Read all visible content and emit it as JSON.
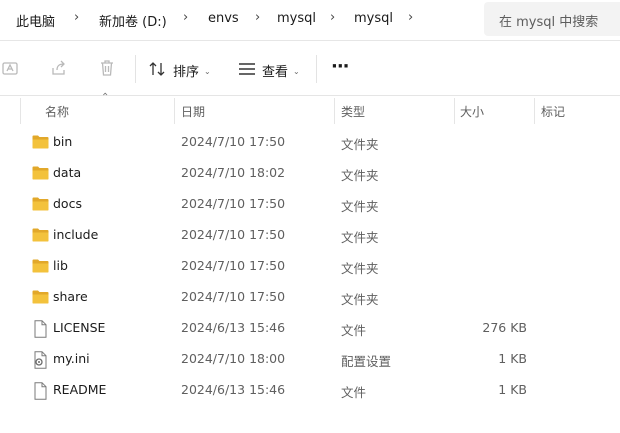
{
  "breadcrumb": [
    "此电脑",
    "新加卷 (D:)",
    "envs",
    "mysql",
    "mysql"
  ],
  "search": {
    "placeholder": "在 mysql 中搜索"
  },
  "toolbar": {
    "sort_label": "排序",
    "view_label": "查看",
    "more_label": "···"
  },
  "columns": {
    "name": "名称",
    "date": "日期",
    "type": "类型",
    "size": "大小",
    "tags": "标记"
  },
  "files": [
    {
      "name": "bin",
      "date": "2024/7/10 17:50",
      "type": "文件夹",
      "size": "",
      "icon": "folder-icon"
    },
    {
      "name": "data",
      "date": "2024/7/10 18:02",
      "type": "文件夹",
      "size": "",
      "icon": "folder-icon"
    },
    {
      "name": "docs",
      "date": "2024/7/10 17:50",
      "type": "文件夹",
      "size": "",
      "icon": "folder-icon"
    },
    {
      "name": "include",
      "date": "2024/7/10 17:50",
      "type": "文件夹",
      "size": "",
      "icon": "folder-icon"
    },
    {
      "name": "lib",
      "date": "2024/7/10 17:50",
      "type": "文件夹",
      "size": "",
      "icon": "folder-icon"
    },
    {
      "name": "share",
      "date": "2024/7/10 17:50",
      "type": "文件夹",
      "size": "",
      "icon": "folder-icon"
    },
    {
      "name": "LICENSE",
      "date": "2024/6/13 15:46",
      "type": "文件",
      "size": "276 KB",
      "icon": "file-icon"
    },
    {
      "name": "my.ini",
      "date": "2024/7/10 18:00",
      "type": "配置设置",
      "size": "1 KB",
      "icon": "settings-file-icon"
    },
    {
      "name": "README",
      "date": "2024/6/13 15:46",
      "type": "文件",
      "size": "1 KB",
      "icon": "file-icon"
    }
  ],
  "colors": {
    "folder": "#f3c23c",
    "folder_dark": "#e2a82a",
    "muted_icon": "#b9b9b9",
    "text": "#1b1b1b",
    "secondary_text": "#5f5f5f"
  }
}
